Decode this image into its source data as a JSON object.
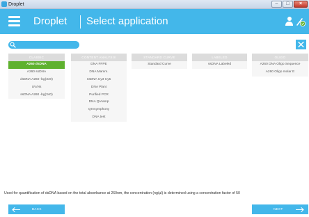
{
  "window": {
    "title": "Droplet",
    "controls": {
      "minimize_icon": "minimize-icon",
      "maximize_icon": "maximize-icon",
      "close_icon": "close-icon"
    }
  },
  "header": {
    "app_name": "Droplet",
    "page_title": "Select application",
    "menu_icon": "hamburger-icon",
    "user_icon": "user-icon",
    "status_icon": "connection-status-icon"
  },
  "search": {
    "value": "",
    "placeholder": "",
    "icon": "search-icon",
    "clear_icon": "close-icon"
  },
  "columns": [
    {
      "header": "CLASSIC",
      "items": [
        {
          "label": "A260 dsDNA",
          "selected": true
        },
        {
          "label": "A260 ssDNA",
          "selected": false
        },
        {
          "label": "dsDNA A260 -bg(340)",
          "selected": false
        },
        {
          "label": "UV/vis",
          "selected": false
        },
        {
          "label": "ssDNA A260 -bg(340)",
          "selected": false
        }
      ]
    },
    {
      "header": "CONTENT ANALYSIS",
      "items": [
        {
          "label": "DNA FFPE",
          "selected": false
        },
        {
          "label": "DNA Mamm.",
          "selected": false
        },
        {
          "label": "ssDNA Cy3 Cy5",
          "selected": false
        },
        {
          "label": "DNA Plant",
          "selected": false
        },
        {
          "label": "Purified PCR",
          "selected": false
        },
        {
          "label": "DNA QIAamp",
          "selected": false
        },
        {
          "label": "QIAsymphony",
          "selected": false
        },
        {
          "label": "DNA test",
          "selected": false
        }
      ]
    },
    {
      "header": "STANDARD CURVE",
      "items": [
        {
          "label": "Standard Curve",
          "selected": false
        }
      ]
    },
    {
      "header": "LABELED",
      "items": [
        {
          "label": "ssDNA Labeled",
          "selected": false
        }
      ]
    },
    {
      "header": "OLIGO",
      "items": [
        {
          "label": "A260 DNA Oligo Sequence",
          "selected": false
        },
        {
          "label": "A260 Oligo molar E",
          "selected": false
        }
      ]
    }
  ],
  "description": "Used for quantification of dsDNA based on the total absorbance at 260nm, the concentration (ng/µl) is determined using a concentration factor of 50",
  "footer": {
    "back_label": "BACK",
    "next_label": "NEXT",
    "back_icon": "arrow-left-icon",
    "next_icon": "arrow-right-icon"
  },
  "colors": {
    "accent": "#43b7ea",
    "selected": "#5fb12f",
    "column_header": "#dcdcdc",
    "item_background": "#f6f6f6"
  }
}
